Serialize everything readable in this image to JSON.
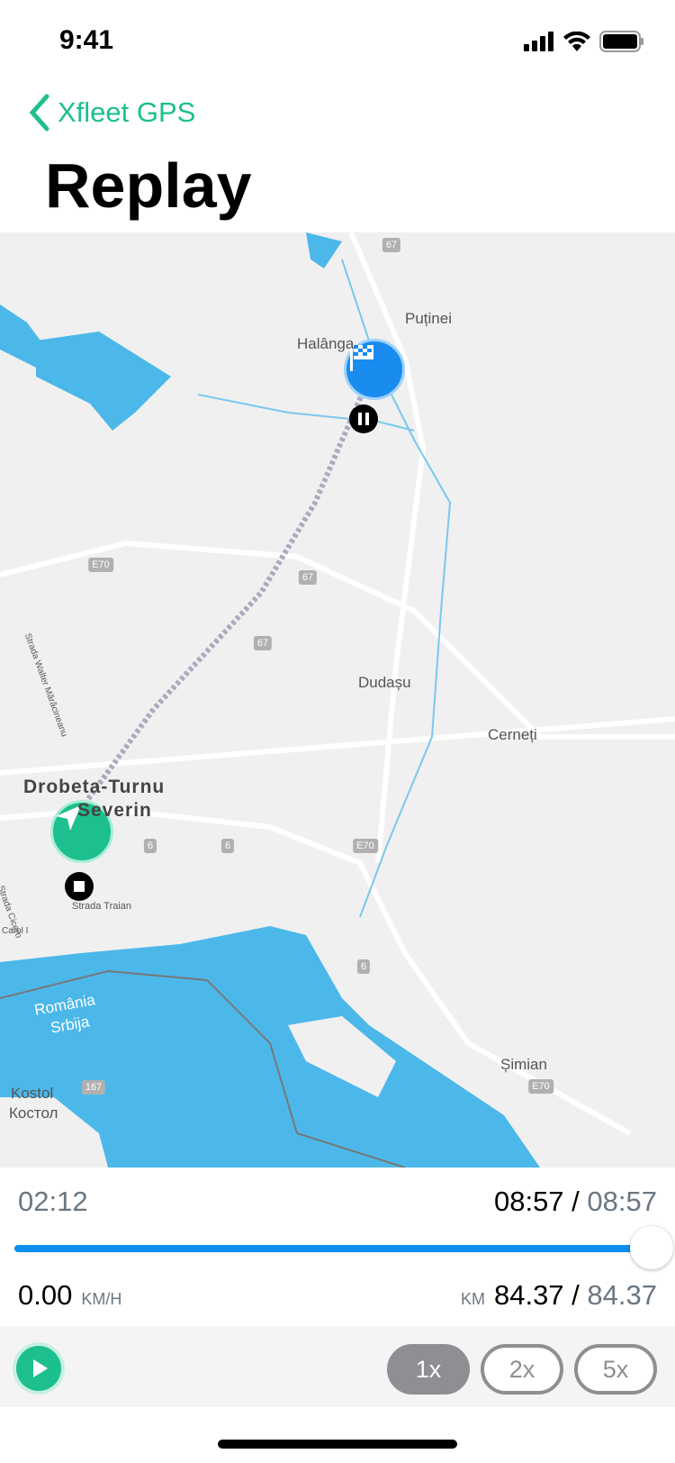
{
  "status_bar": {
    "time": "9:41",
    "icons": [
      "signal-icon",
      "wifi-icon",
      "battery-icon"
    ]
  },
  "nav": {
    "back_label": "Xfleet GPS",
    "title": "Replay"
  },
  "map": {
    "labels": [
      "Puținei",
      "Halânga",
      "Dudașu",
      "Cerneți",
      "Drobeta-Turnu",
      "Severin",
      "Strada Traian",
      "România",
      "Srbija",
      "Kostol",
      "Костол",
      "Șimian",
      "Strada Walter Mărăcineanu",
      "Strada Cicero",
      "Carol I"
    ],
    "road_shields": [
      "67",
      "E70",
      "67",
      "67",
      "6",
      "6",
      "E70",
      "6",
      "167",
      "E70"
    ],
    "colors": {
      "water": "#4cb8ea",
      "land": "#f0f0f0",
      "route": "#a9acbf",
      "start": "#1dbf8e",
      "finish": "#1a8cf0"
    }
  },
  "playback": {
    "elapsed": "02:12",
    "current_time": "08:57",
    "total_time": "08:57",
    "progress_percent": 100,
    "speed_value": "0.00",
    "speed_unit": "KM/H",
    "distance_unit": "KM",
    "distance_current": "84.37",
    "distance_total": "84.37",
    "separator": "/"
  },
  "controls": {
    "speeds": [
      "1x",
      "2x",
      "5x"
    ],
    "active_speed": "1x"
  }
}
